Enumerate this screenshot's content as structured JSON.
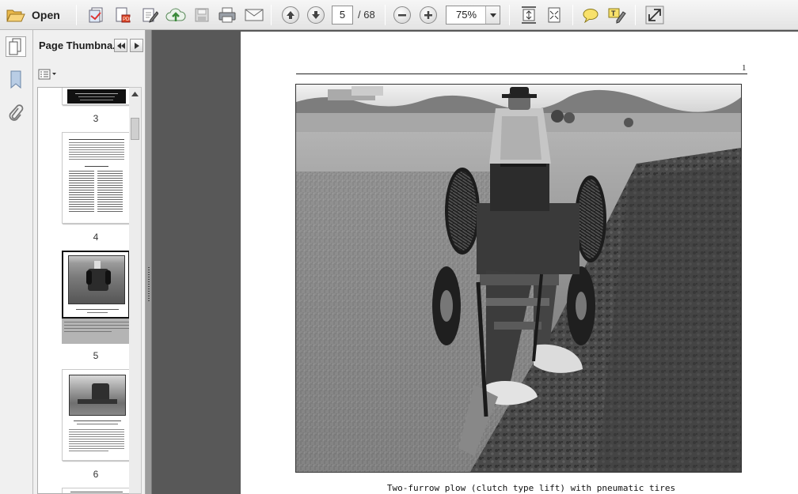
{
  "toolbar": {
    "open_label": "Open",
    "current_page": "5",
    "page_total": "/ 68",
    "zoom_level": "75%",
    "icons": [
      "folder-open-icon",
      "create-pdf-icon",
      "edit-pdf-icon",
      "sign-icon",
      "cloud-upload-icon",
      "save-icon",
      "print-icon",
      "email-icon",
      "previous-page-icon",
      "next-page-icon",
      "zoom-out-icon",
      "zoom-in-icon",
      "fit-page-icon",
      "fit-width-icon",
      "comment-icon",
      "highlight-icon",
      "fullscreen-icon"
    ]
  },
  "sidebar": {
    "panel_title": "Page Thumbna...",
    "selected_page": "5",
    "thumbnails": [
      {
        "label": "3"
      },
      {
        "label": "4"
      },
      {
        "label": "5"
      },
      {
        "label": "6"
      }
    ]
  },
  "document": {
    "page_number": "1",
    "caption": "Two-furrow plow (clutch type lift) with pneumatic tires"
  },
  "colors": {
    "toolbar_bg": "#ebebeb",
    "workspace_bg": "#585858",
    "panel_bg": "#f0f0f0",
    "selection_gray": "#b4b4b4"
  }
}
